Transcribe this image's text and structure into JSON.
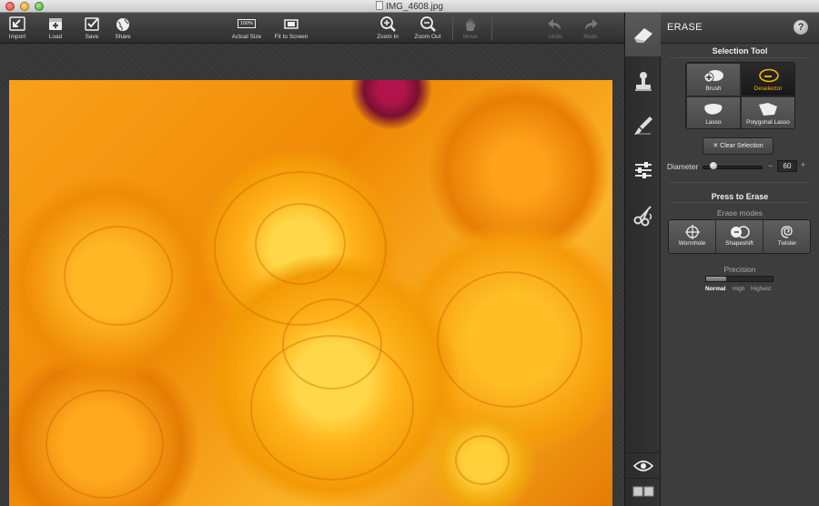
{
  "window": {
    "title": "IMG_4608.jpg"
  },
  "toolbar": {
    "import": "Import",
    "load": "Load",
    "save": "Save",
    "share": "Share",
    "actual_size": "Actual Size",
    "actual_size_badge": "100%",
    "fit_to_screen": "Fit to Screen",
    "zoom_in": "Zoom In",
    "zoom_out": "Zoom Out",
    "move": "Move",
    "undo": "Undo",
    "redo": "Redo"
  },
  "panel": {
    "title": "ERASE",
    "help": "?",
    "selection_tool": {
      "heading": "Selection Tool",
      "tools": [
        {
          "label": "Brush",
          "active": false
        },
        {
          "label": "Deselector",
          "active": true
        },
        {
          "label": "Lasso",
          "active": false
        },
        {
          "label": "Polygonal Lasso",
          "active": false
        }
      ],
      "clear_label": "Clear Selection",
      "diameter_label": "Diameter",
      "diameter_value": "60",
      "diameter_fraction": 0.18
    },
    "press_to_erase": {
      "heading": "Press to Erase",
      "modes_heading": "Erase modes",
      "modes": [
        "Wormhole",
        "Shapeshift",
        "Twister"
      ]
    },
    "precision": {
      "heading": "Precision",
      "options": [
        "Normal",
        "High",
        "Highest"
      ],
      "selected": "Normal",
      "level_fraction": 0.3
    }
  },
  "toolstrip": {
    "tools": [
      "eraser-icon",
      "stamp-icon",
      "brush-icon",
      "sliders-icon",
      "scissors-icon"
    ],
    "active": "eraser-icon"
  },
  "colors": {
    "accent": "#f0a00a",
    "panel_bg": "#3d3d3d",
    "toolbar_bg": "#3a3a3a"
  }
}
